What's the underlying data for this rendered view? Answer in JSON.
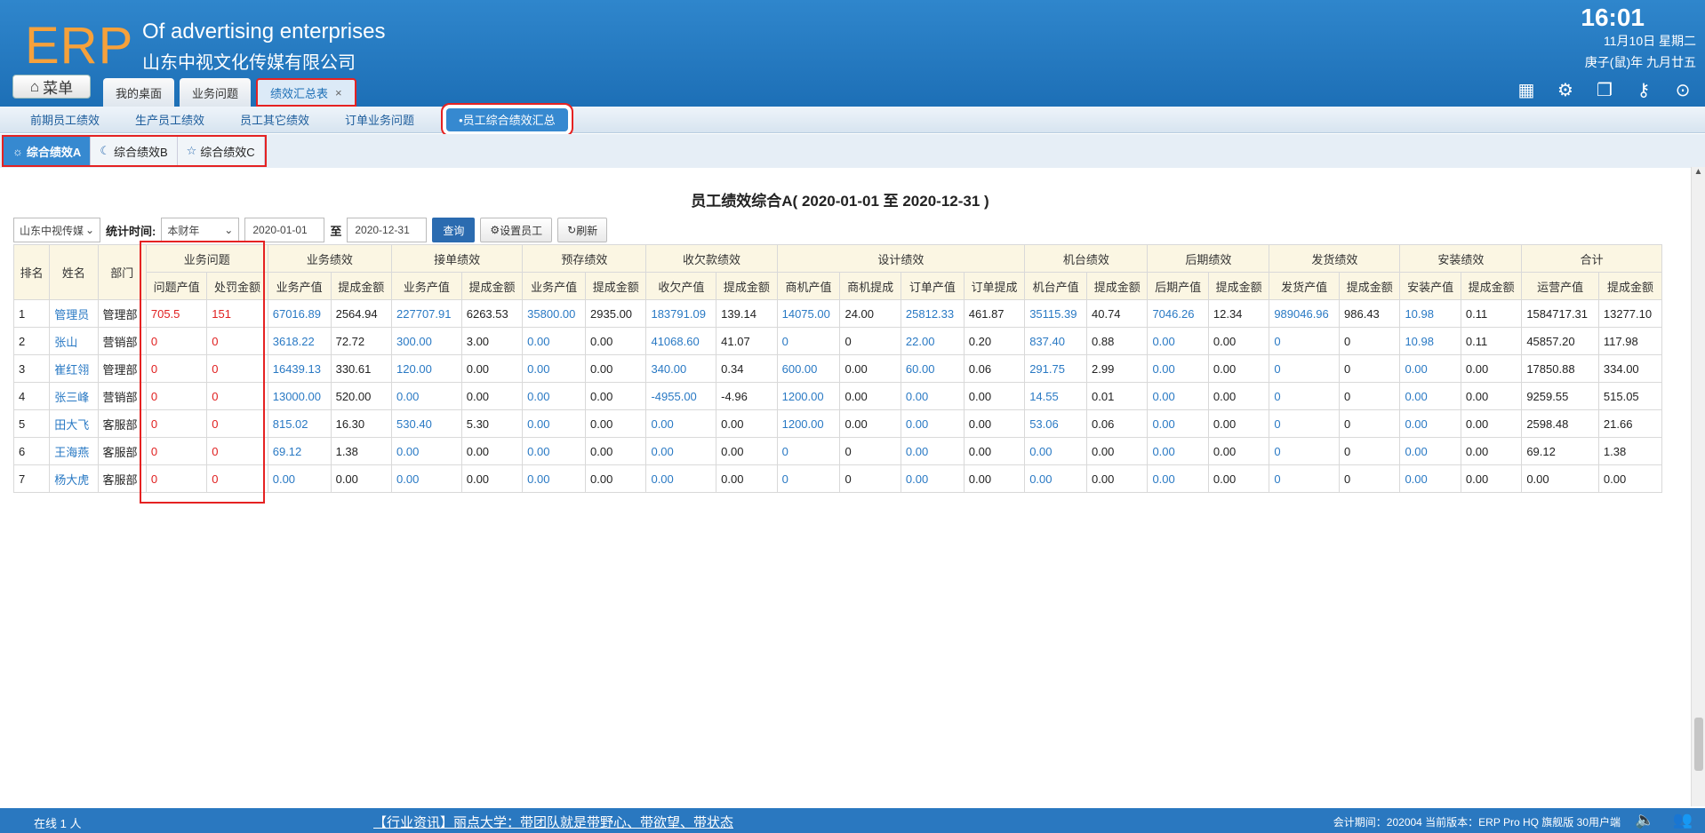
{
  "header": {
    "logo": "ERP",
    "brand_en": "Of advertising enterprises",
    "brand_cn": "山东中视文化传媒有限公司",
    "time": "16:01",
    "date": "11月10日 星期二",
    "lunar": "庚子(鼠)年 九月廿五",
    "menu_label": "菜单",
    "tabs": [
      {
        "label": "我的桌面"
      },
      {
        "label": "业务问题"
      },
      {
        "label": "绩效汇总表",
        "close": "×"
      }
    ]
  },
  "subnav": [
    "前期员工绩效",
    "生产员工绩效",
    "员工其它绩效",
    "订单业务问题",
    "•员工综合绩效汇总"
  ],
  "perf_tabs": [
    {
      "icon": "sun-icon",
      "label": "综合绩效A"
    },
    {
      "icon": "moon-icon",
      "label": "综合绩效B"
    },
    {
      "icon": "star-icon",
      "label": "综合绩效C"
    }
  ],
  "report": {
    "title": "员工绩效综合A( 2020-01-01 至 2020-12-31 )",
    "company_select": "山东中视传媒",
    "period_label": "统计时间:",
    "period_select": "本财年",
    "date_from": "2020-01-01",
    "to_label": "至",
    "date_to": "2020-12-31",
    "query_btn": "查询",
    "set_staff_btn": "设置员工",
    "refresh_btn": "刷新"
  },
  "table": {
    "fixed_headers": [
      "排名",
      "姓名",
      "部门"
    ],
    "groups": [
      "业务问题",
      "业务绩效",
      "接单绩效",
      "预存绩效",
      "收欠款绩效",
      "设计绩效",
      "机台绩效",
      "后期绩效",
      "发货绩效",
      "安装绩效",
      "合计"
    ],
    "sub_headers": [
      "问题产值",
      "处罚金额",
      "业务产值",
      "提成金额",
      "业务产值",
      "提成金额",
      "业务产值",
      "提成金额",
      "收欠产值",
      "提成金额",
      "商机产值",
      "商机提成",
      "订单产值",
      "订单提成",
      "机台产值",
      "提成金额",
      "后期产值",
      "提成金额",
      "发货产值",
      "提成金额",
      "安装产值",
      "提成金额",
      "运营产值",
      "提成金额"
    ],
    "rows": [
      [
        "1",
        "管理员",
        "管理部",
        "705.5",
        "151",
        "67016.89",
        "2564.94",
        "227707.91",
        "6263.53",
        "35800.00",
        "2935.00",
        "183791.09",
        "139.14",
        "14075.00",
        "24.00",
        "25812.33",
        "461.87",
        "35115.39",
        "40.74",
        "7046.26",
        "12.34",
        "989046.96",
        "986.43",
        "10.98",
        "0.11",
        "1584717.31",
        "13277.10"
      ],
      [
        "2",
        "张山",
        "营销部",
        "0",
        "0",
        "3618.22",
        "72.72",
        "300.00",
        "3.00",
        "0.00",
        "0.00",
        "41068.60",
        "41.07",
        "0",
        "0",
        "22.00",
        "0.20",
        "837.40",
        "0.88",
        "0.00",
        "0.00",
        "0",
        "0",
        "10.98",
        "0.11",
        "45857.20",
        "117.98"
      ],
      [
        "3",
        "崔红翎",
        "管理部",
        "0",
        "0",
        "16439.13",
        "330.61",
        "120.00",
        "0.00",
        "0.00",
        "0.00",
        "340.00",
        "0.34",
        "600.00",
        "0.00",
        "60.00",
        "0.06",
        "291.75",
        "2.99",
        "0.00",
        "0.00",
        "0",
        "0",
        "0.00",
        "0.00",
        "17850.88",
        "334.00"
      ],
      [
        "4",
        "张三峰",
        "营销部",
        "0",
        "0",
        "13000.00",
        "520.00",
        "0.00",
        "0.00",
        "0.00",
        "0.00",
        "-4955.00",
        "-4.96",
        "1200.00",
        "0.00",
        "0.00",
        "0.00",
        "14.55",
        "0.01",
        "0.00",
        "0.00",
        "0",
        "0",
        "0.00",
        "0.00",
        "9259.55",
        "515.05"
      ],
      [
        "5",
        "田大飞",
        "客服部",
        "0",
        "0",
        "815.02",
        "16.30",
        "530.40",
        "5.30",
        "0.00",
        "0.00",
        "0.00",
        "0.00",
        "1200.00",
        "0.00",
        "0.00",
        "0.00",
        "53.06",
        "0.06",
        "0.00",
        "0.00",
        "0",
        "0",
        "0.00",
        "0.00",
        "2598.48",
        "21.66"
      ],
      [
        "6",
        "王海燕",
        "客服部",
        "0",
        "0",
        "69.12",
        "1.38",
        "0.00",
        "0.00",
        "0.00",
        "0.00",
        "0.00",
        "0.00",
        "0",
        "0",
        "0.00",
        "0.00",
        "0.00",
        "0.00",
        "0.00",
        "0.00",
        "0",
        "0",
        "0.00",
        "0.00",
        "69.12",
        "1.38"
      ],
      [
        "7",
        "杨大虎",
        "客服部",
        "0",
        "0",
        "0.00",
        "0.00",
        "0.00",
        "0.00",
        "0.00",
        "0.00",
        "0.00",
        "0.00",
        "0",
        "0",
        "0.00",
        "0.00",
        "0.00",
        "0.00",
        "0.00",
        "0.00",
        "0",
        "0",
        "0.00",
        "0.00",
        "0.00",
        "0.00"
      ]
    ]
  },
  "footer": {
    "online": "在线  1  人",
    "news": "【行业资讯】丽点大学：带团队就是带野心、带欲望、带状态",
    "info": "会计期间：202004 当前版本：ERP Pro HQ 旗舰版 30用户端"
  },
  "colors": {
    "header_blue": "#2f86cc",
    "accent_orange": "#f6a13b",
    "link_blue": "#2979c4",
    "alert_red": "#e02020",
    "highlight_box": "#e52222"
  }
}
